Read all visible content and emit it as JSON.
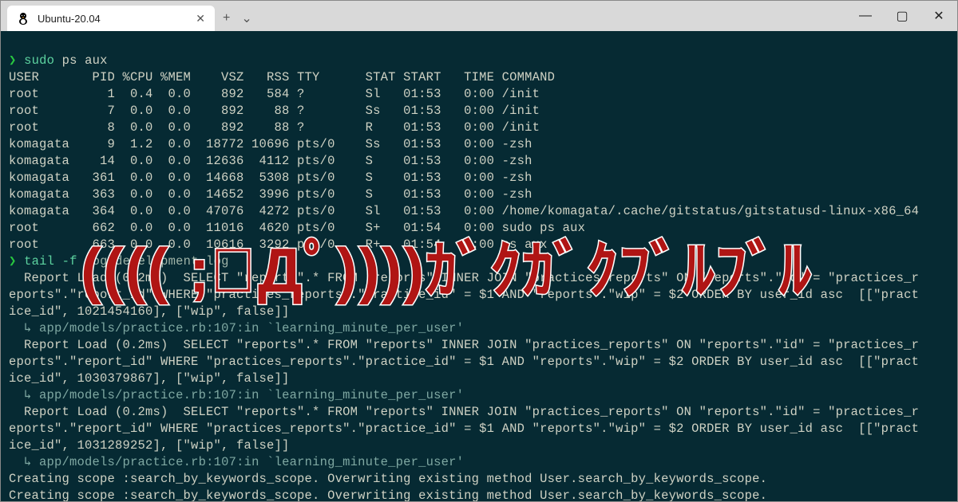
{
  "window": {
    "tab_title": "Ubuntu-20.04",
    "new_tab_icon": "+",
    "dropdown_icon": "⌄",
    "min": "—",
    "max": "▢",
    "close": "✕",
    "tab_close": "✕"
  },
  "prompt1": {
    "sym": "❯",
    "cmd": "sudo",
    "rest": "ps aux"
  },
  "ps_header": "USER       PID %CPU %MEM    VSZ   RSS TTY      STAT START   TIME COMMAND",
  "ps_rows": [
    "root         1  0.4  0.0    892   584 ?        Sl   01:53   0:00 /init",
    "root         7  0.0  0.0    892    88 ?        Ss   01:53   0:00 /init",
    "root         8  0.0  0.0    892    88 ?        R    01:53   0:00 /init",
    "komagata     9  1.2  0.0  18772 10696 pts/0    Ss   01:53   0:00 -zsh",
    "komagata    14  0.0  0.0  12636  4112 pts/0    S    01:53   0:00 -zsh",
    "komagata   361  0.0  0.0  14668  5308 pts/0    S    01:53   0:00 -zsh",
    "komagata   363  0.0  0.0  14652  3996 pts/0    S    01:53   0:00 -zsh",
    "komagata   364  0.0  0.0  47076  4272 pts/0    Sl   01:53   0:00 /home/komagata/.cache/gitstatus/gitstatusd-linux-x86_64",
    "root       662  0.0  0.0  11016  4620 pts/0    S+   01:54   0:00 sudo ps aux",
    "root       663  0.0  0.0  10616  3292 pts/0    R+   01:54   0:00 ps aux"
  ],
  "prompt2": {
    "sym": "❯",
    "cmd": "tail",
    "flag": "-f",
    "path": "log/development.log"
  },
  "log_lines": [
    "  Report Load (0.2ms)  SELECT \"reports\".* FROM \"reports\" INNER JOIN \"practices_reports\" ON \"reports\".\"id\" = \"practices_r",
    "eports\".\"report_id\" WHERE \"practices_reports\".\"practice_id\" = $1 AND \"reports\".\"wip\" = $2 ORDER BY user_id asc  [[\"pract",
    "ice_id\", 1021454160], [\"wip\", false]]",
    "  ↳ app/models/practice.rb:107:in `learning_minute_per_user'",
    "  Report Load (0.2ms)  SELECT \"reports\".* FROM \"reports\" INNER JOIN \"practices_reports\" ON \"reports\".\"id\" = \"practices_r",
    "eports\".\"report_id\" WHERE \"practices_reports\".\"practice_id\" = $1 AND \"reports\".\"wip\" = $2 ORDER BY user_id asc  [[\"pract",
    "ice_id\", 1030379867], [\"wip\", false]]",
    "  ↳ app/models/practice.rb:107:in `learning_minute_per_user'",
    "  Report Load (0.2ms)  SELECT \"reports\".* FROM \"reports\" INNER JOIN \"practices_reports\" ON \"reports\".\"id\" = \"practices_r",
    "eports\".\"report_id\" WHERE \"practices_reports\".\"practice_id\" = $1 AND \"reports\".\"wip\" = $2 ORDER BY user_id asc  [[\"pract",
    "ice_id\", 1031289252], [\"wip\", false]]",
    "  ↳ app/models/practice.rb:107:in `learning_minute_per_user'",
    "Creating scope :search_by_keywords_scope. Overwriting existing method User.search_by_keywords_scope.",
    "Creating scope :search_by_keywords_scope. Overwriting existing method User.search_by_keywords_scope."
  ],
  "overlay_text": "(((( ;ﾟДﾟ))))ｶﾞｸｶﾞｸﾌﾞﾙﾌﾞﾙ"
}
